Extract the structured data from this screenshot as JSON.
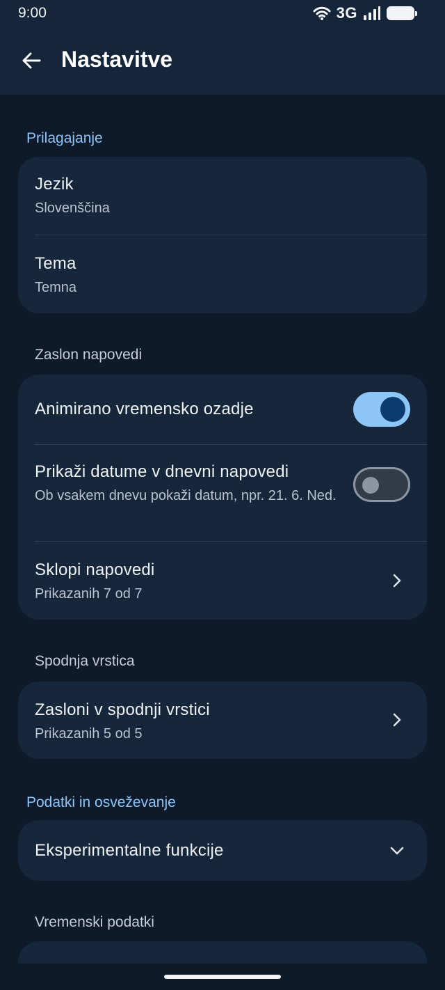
{
  "status_bar": {
    "time": "9:00",
    "network": "3G",
    "icons": [
      "wifi-icon",
      "cellular-signal-icon",
      "battery-icon"
    ]
  },
  "app_bar": {
    "title": "Nastavitve",
    "back_icon": "arrow-left-icon"
  },
  "sections": {
    "personalization": {
      "label": "Prilagajanje",
      "items": [
        {
          "title": "Jezik",
          "subtitle": "Slovenščina"
        },
        {
          "title": "Tema",
          "subtitle": "Temna"
        }
      ]
    },
    "forecast_screen": {
      "label": "Zaslon napovedi",
      "items": [
        {
          "title": "Animirano vremensko ozadje",
          "toggle": true
        },
        {
          "title": "Prikaži datume v dnevni napovedi",
          "subtitle": "Ob vsakem dnevu pokaži datum, npr. 21. 6. Ned.",
          "toggle": false
        },
        {
          "title": "Sklopi napovedi",
          "subtitle": "Prikazanih 7 od 7",
          "icon": "chevron-right-icon"
        }
      ]
    },
    "bottom_bar": {
      "label": "Spodnja vrstica",
      "items": [
        {
          "title": "Zasloni v spodnji vrstici",
          "subtitle": "Prikazanih 5 od 5",
          "icon": "chevron-right-icon"
        }
      ]
    },
    "data_refresh": {
      "label": "Podatki in osveževanje",
      "items": [
        {
          "title": "Eksperimentalne funkcije",
          "icon": "chevron-down-icon"
        }
      ]
    },
    "weather_data": {
      "label": "Vremenski podatki"
    }
  },
  "colors": {
    "background": "#0e1a29",
    "app_bar": "#15263a",
    "card": "#17273b",
    "accent": "#8ec5f7",
    "toggle_knob_on": "#0b3c6e"
  }
}
